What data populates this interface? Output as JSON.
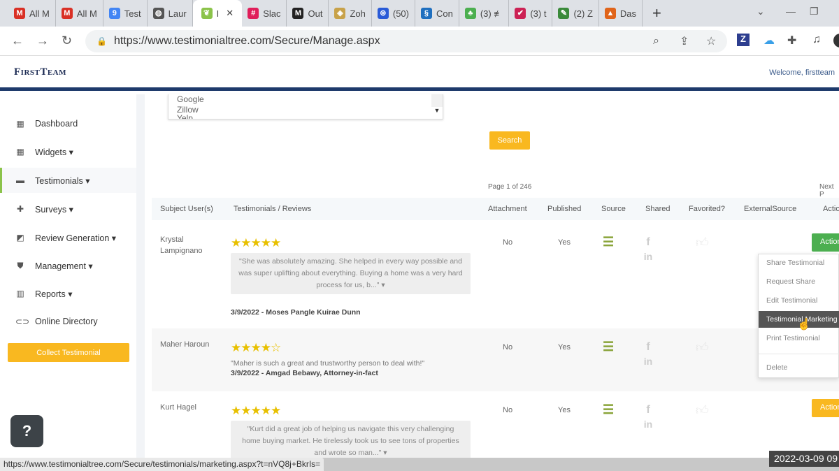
{
  "browser": {
    "tabs": [
      {
        "label": "All M",
        "icon": "gmail-icon",
        "color": "#d93025",
        "glyph": "M"
      },
      {
        "label": "All M",
        "icon": "gmail-icon",
        "color": "#d93025",
        "glyph": "M"
      },
      {
        "label": "Test",
        "icon": "calendar-icon",
        "color": "#4285f4",
        "glyph": "9"
      },
      {
        "label": "Laur",
        "icon": "globe-icon",
        "color": "#555",
        "glyph": "◍"
      },
      {
        "label": "I",
        "icon": "testimonialtree-icon",
        "color": "#8bc34a",
        "glyph": "❦",
        "active": true
      },
      {
        "label": "Slac",
        "icon": "slack-icon",
        "color": "#e01e5a",
        "glyph": "#"
      },
      {
        "label": "Out",
        "icon": "mail-icon",
        "color": "#222",
        "glyph": "M"
      },
      {
        "label": "Zoh",
        "icon": "zoho-icon",
        "color": "#c8a24a",
        "glyph": "◈"
      },
      {
        "label": "(50)",
        "icon": "link-icon",
        "color": "#2a5bd7",
        "glyph": "⊚"
      },
      {
        "label": "Con",
        "icon": "contact-icon",
        "color": "#1f6fbf",
        "glyph": "§"
      },
      {
        "label": "(3) ≢",
        "icon": "app-icon",
        "color": "#4caf50",
        "glyph": "♣"
      },
      {
        "label": "(3) t",
        "icon": "check-icon",
        "color": "#c25",
        "glyph": "✔"
      },
      {
        "label": "(2) Z",
        "icon": "feather-icon",
        "color": "#3a8a3a",
        "glyph": "✎"
      },
      {
        "label": "Das",
        "icon": "dashboard-icon",
        "color": "#e0641a",
        "glyph": "▲"
      }
    ],
    "url": "https://www.testimonialtree.com/Secure/Manage.aspx",
    "status_url": "https://www.testimonialtree.com/Secure/testimonials/marketing.aspx?t=nVQ8j+BkrIs=",
    "timestamp": "2022-03-09 09"
  },
  "header": {
    "logo": "FirstTeam",
    "welcome": "Welcome, firstteam"
  },
  "sidebar": {
    "items": [
      {
        "label": "Dashboard",
        "icon": "dashboard-icon",
        "glyph": "▦"
      },
      {
        "label": "Widgets ▾",
        "icon": "widgets-icon",
        "glyph": "▦"
      },
      {
        "label": "Testimonials ▾",
        "icon": "comment-icon",
        "glyph": "▬",
        "active": true
      },
      {
        "label": "Surveys ▾",
        "icon": "puzzle-icon",
        "glyph": "✚"
      },
      {
        "label": "Review Generation ▾",
        "icon": "image-icon",
        "glyph": "◩"
      },
      {
        "label": "Management ▾",
        "icon": "shield-icon",
        "glyph": "⛊"
      },
      {
        "label": "Reports ▾",
        "icon": "chart-icon",
        "glyph": "▥"
      },
      {
        "label": "Online Directory",
        "icon": "link-icon",
        "glyph": "⊂⊃"
      }
    ],
    "collect_button": "Collect Testimonial",
    "help": "?"
  },
  "filters": {
    "sources": [
      "Google",
      "Zillow",
      "Yelp"
    ],
    "search_button": "Search"
  },
  "pagination": {
    "page_info": "Page 1 of 246",
    "next": "Next P"
  },
  "table": {
    "headers": [
      "Subject User(s)",
      "Testimonials / Reviews",
      "Attachment",
      "Published",
      "Source",
      "Shared",
      "Favorited?",
      "ExternalSource",
      "Actio"
    ],
    "rows": [
      {
        "subject": "Krystal\nLampignano",
        "stars": "★★★★★",
        "rating": 5,
        "quote": "\"She was absolutely amazing. She helped in every way possible and was super uplifting about everything. Buying a home was a very hard process for us, b...\" ▾",
        "date": "3/9/2022 - Moses Pangle Kuirae Dunn",
        "attachment": "No",
        "published": "Yes",
        "action": "Action",
        "action_color": "#4caf50"
      },
      {
        "subject": "Maher Haroun",
        "stars": "★★★★☆",
        "rating": 4,
        "quote": "\"Maher is such a great and trustworthy person to deal with!\"",
        "date": "3/9/2022 - Amgad Bebawy, Attorney-in-fact",
        "attachment": "No",
        "published": "Yes"
      },
      {
        "subject": "Kurt Hagel",
        "stars": "★★★★★",
        "rating": 5,
        "quote": "\"Kurt did a great job of helping us navigate this very challenging home buying market. He tirelessly took us to see tons of properties and wrote so man...\" ▾",
        "attachment": "No",
        "published": "Yes",
        "action": "Action",
        "action_color": "#f9b820"
      }
    ]
  },
  "action_menu": [
    "Share Testimonial",
    "Request Share",
    "Edit Testimonial",
    "Testimonial Marketing",
    "Print Testimonial",
    "Delete"
  ]
}
